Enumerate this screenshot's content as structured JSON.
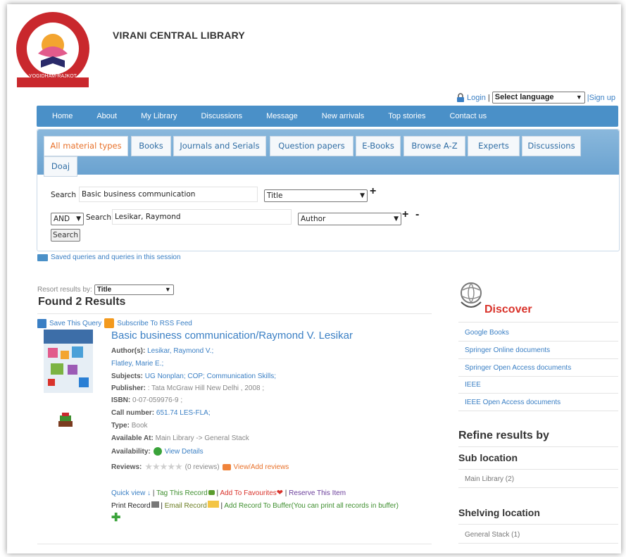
{
  "library": {
    "name": "VIRANI CENTRAL LIBRARY",
    "logo_top_text": "SARVODAY KELAVANI SAMAJ",
    "logo_bottom_text": "YOGIDHAM-RAJKOT"
  },
  "topbar": {
    "login": "Login",
    "separator": "|",
    "language_selected": "Select language",
    "signup": "|Sign up"
  },
  "nav": [
    "Home",
    "About",
    "My Library",
    "Discussions",
    "Message",
    "New arrivals",
    "Top stories",
    "Contact us"
  ],
  "tabs": [
    "All material types",
    "Books",
    "Journals and Serials",
    "Question papers",
    "E-Books",
    "Browse A-Z",
    "Experts",
    "Discussions",
    "Doaj"
  ],
  "search": {
    "label": "Search",
    "query1": "Basic business communication",
    "field1": "Title",
    "operator": "AND",
    "query2_label": "Search",
    "query2": "Lesikar, Raymond",
    "field2": "Author",
    "plus": "+",
    "minus": "-",
    "button": "Search"
  },
  "saved_queries": "Saved queries and queries in this session",
  "results": {
    "resort_label": "Resort results by:",
    "resort_value": "Title",
    "found": "Found 2 Results",
    "save_query": "Save This Query",
    "rss": "Subscribe To RSS Feed"
  },
  "record": {
    "title": "Basic business communication/Raymond V. Lesikar",
    "authors_label": "Author(s):",
    "author1": "Lesikar, Raymond V.;",
    "author2": "Flatley, Marie E.;",
    "subjects_label": "Subjects:",
    "subjects": "UG Nonplan; COP; Communication Skills;",
    "publisher_label": "Publisher:",
    "publisher": ": Tata McGraw Hill New Delhi , 2008 ;",
    "isbn_label": "ISBN:",
    "isbn": "0-07-059976-9 ;",
    "call_label": "Call number:",
    "call": "651.74 LES-FLA;",
    "type_label": "Type:",
    "type": "Book",
    "available_label": "Available At:",
    "available": "Main Library -> General Stack",
    "availability_label": "Availability:",
    "view_details": "View Details",
    "reviews_label": "Reviews:",
    "reviews_count": "(0 reviews)",
    "view_add_reviews": "View/Add reviews",
    "actions1": {
      "quick_view": "Quick view ↓",
      "sep": " | ",
      "tag": "Tag This Record",
      "favourites": "Add To Favourites",
      "reserve": "Reserve This Item"
    },
    "actions2": {
      "print": "Print Record",
      "email": "Email Record",
      "buffer": "Add Record To Buffer(You can print all records in buffer)"
    }
  },
  "sidebar": {
    "discover": "Discover",
    "links": [
      "Google Books",
      "Springer Online documents",
      "Springer Open Access documents",
      "IEEE",
      "IEEE Open Access documents"
    ],
    "refine": "Refine results by",
    "sub_location": "Sub location",
    "sub_location_items": [
      "Main Library (2)"
    ],
    "shelving_location": "Shelving location",
    "shelving_items": [
      "General Stack (1)"
    ]
  },
  "colors": {
    "nav_bg": "#4a90c8",
    "link": "#3a7fc4",
    "active_tab": "#e8712a",
    "discover": "#d9332b"
  }
}
